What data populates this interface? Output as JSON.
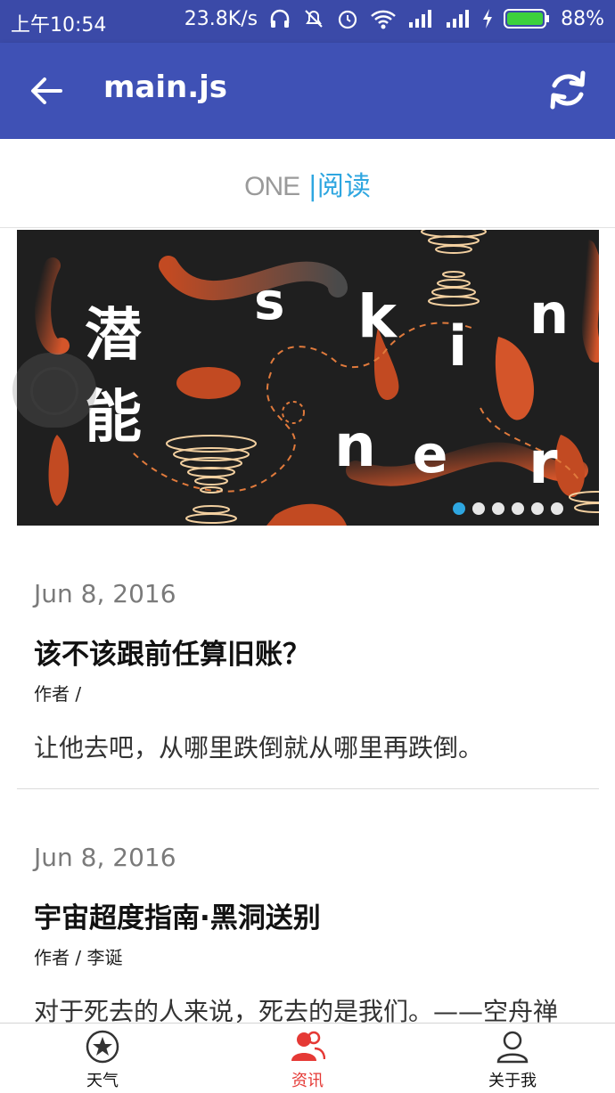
{
  "status_bar": {
    "time": "上午10:54",
    "speed": "23.8K/s",
    "battery": "88%"
  },
  "app_bar": {
    "title": "main.js"
  },
  "header": {
    "logo_one": "ONE",
    "logo_sep": "|",
    "logo_read": "阅读"
  },
  "banner": {
    "dots_total": 6,
    "active_index": 0,
    "text_left": [
      "潜",
      "能"
    ],
    "text_letters": [
      "s",
      "k",
      "i",
      "n",
      "n",
      "e",
      "r"
    ]
  },
  "articles": [
    {
      "date": "Jun 8, 2016",
      "title": "该不该跟前任算旧账？",
      "author": "作者 /",
      "summary": "让他去吧，从哪里跌倒就从哪里再跌倒。"
    },
    {
      "date": "Jun 8, 2016",
      "title": "宇宙超度指南·黑洞送别",
      "author": "作者 / 李诞",
      "summary": "对于死去的人来说，死去的是我们。——空舟禅"
    }
  ],
  "bottom_nav": {
    "items": [
      {
        "label": "天气",
        "icon": "star-circle-icon"
      },
      {
        "label": "资讯",
        "icon": "people-icon"
      },
      {
        "label": "关于我",
        "icon": "person-icon"
      }
    ],
    "active_index": 1
  },
  "colors": {
    "status_bar": "#3b4aa8",
    "app_bar": "#3f51b5",
    "accent_blue": "#2ea6e0",
    "active_red": "#e53935"
  }
}
